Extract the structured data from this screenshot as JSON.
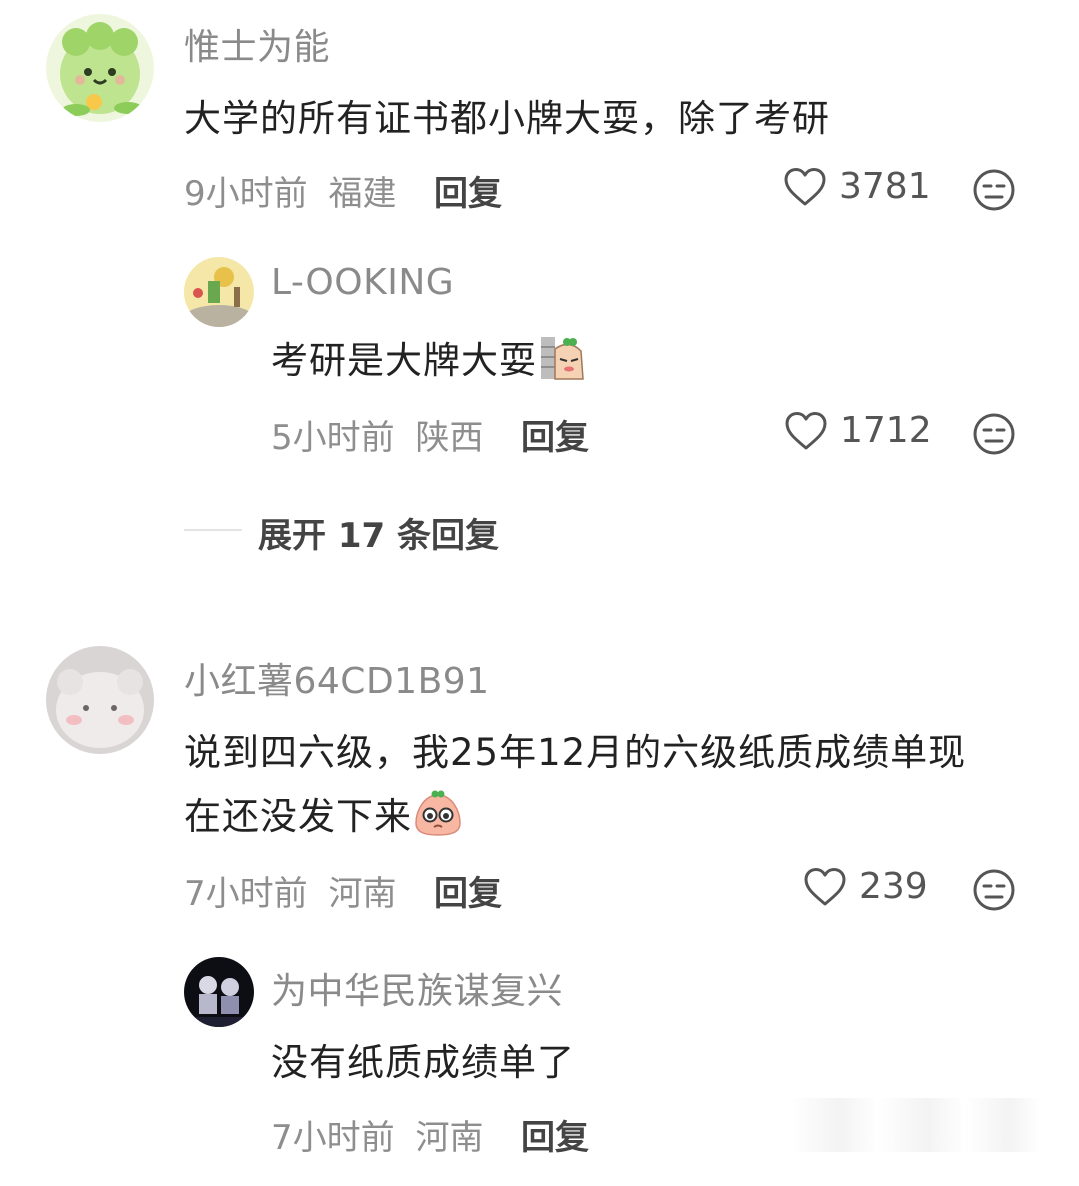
{
  "comments": [
    {
      "username": "惟士为能",
      "text": "大学的所有证书都小牌大耍，除了考研",
      "time": "9小时前",
      "location": "福建",
      "reply_label": "回复",
      "likes": "3781",
      "replies": [
        {
          "username": "L-OOKING",
          "text": "考研是大牌大耍",
          "emoji": "wall-peek-sticker",
          "time": "5小时前",
          "location": "陕西",
          "reply_label": "回复",
          "likes": "1712"
        }
      ],
      "expand_label": "展开 17 条回复"
    },
    {
      "username": "小红薯64CD1B91",
      "text_line1": "说到四六级，我25年12月的六级纸质成绩单现",
      "text_line2": "在还没发下来",
      "emoji": "teary-eyes-sticker",
      "time": "7小时前",
      "location": "河南",
      "reply_label": "回复",
      "likes": "239",
      "replies": [
        {
          "username": "为中华民族谋复兴",
          "text": "没有纸质成绩单了",
          "time": "7小时前",
          "location": "河南",
          "reply_label": "回复"
        }
      ]
    }
  ],
  "colors": {
    "username": "#8a8a8a",
    "body_text": "#222222",
    "meta": "#8e8e8e",
    "action": "#444444",
    "divider": "#e3e3e3"
  },
  "icons": [
    "heart-outline-icon",
    "expressionless-face-icon"
  ]
}
